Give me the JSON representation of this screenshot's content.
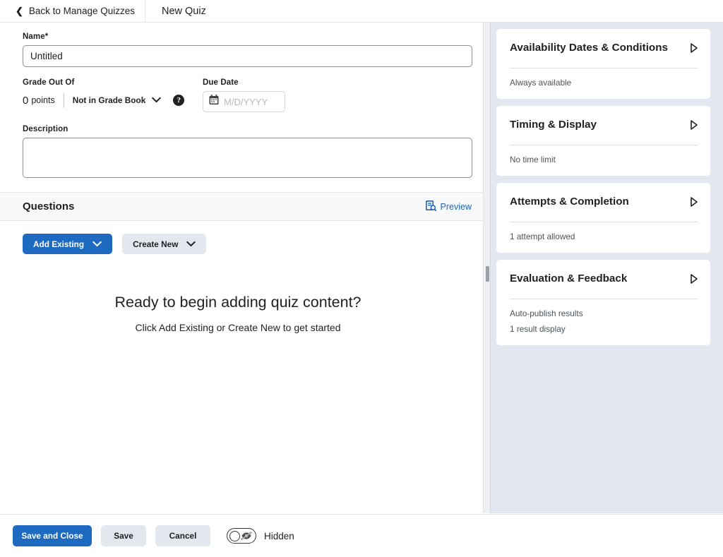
{
  "topbar": {
    "back_label": "Back to Manage Quizzes",
    "back_icon": "chevron-left-icon",
    "tab_label": "New Quiz"
  },
  "form": {
    "name_label": "Name",
    "name_required_marker": "*",
    "name_value": "Untitled",
    "name_placeholder": "Untitled",
    "grade_out_of_label": "Grade Out Of",
    "points_value": "0",
    "points_unit": "points",
    "grade_book_select": "Not in Grade Book",
    "grade_book_chevron": "chevron-down-icon",
    "help_icon": "help-circle-icon",
    "help_glyph": "?",
    "due_date_label": "Due Date",
    "due_date_value": "",
    "due_date_placeholder": "M/D/YYYY",
    "calendar_icon": "calendar-icon",
    "description_label": "Description",
    "description_value": ""
  },
  "questions": {
    "section_title": "Questions",
    "preview_label": "Preview",
    "preview_icon": "document-search-icon",
    "add_existing_label": "Add Existing",
    "add_existing_chevron": "chevron-down-icon",
    "create_new_label": "Create New",
    "create_new_chevron": "chevron-down-icon",
    "empty_title": "Ready to begin adding quiz content?",
    "empty_subtitle": "Click Add Existing or Create New to get started"
  },
  "splitter": {
    "grip_icon": "resize-grip-icon"
  },
  "panel": {
    "cards": [
      {
        "title": "Availability Dates & Conditions",
        "arrow_icon": "triangle-right-icon",
        "lines": [
          "Always available"
        ]
      },
      {
        "title": "Timing & Display",
        "arrow_icon": "triangle-right-icon",
        "lines": [
          "No time limit"
        ]
      },
      {
        "title": "Attempts & Completion",
        "arrow_icon": "triangle-right-icon",
        "lines": [
          "1 attempt allowed"
        ]
      },
      {
        "title": "Evaluation & Feedback",
        "arrow_icon": "triangle-right-icon",
        "lines": [
          "Auto-publish results",
          "1 result display"
        ]
      }
    ]
  },
  "footer": {
    "save_and_close_label": "Save and Close",
    "save_label": "Save",
    "cancel_label": "Cancel",
    "visibility_toggle_state": "off",
    "visibility_toggle_icon": "eye-slash-icon",
    "visibility_label": "Hidden"
  },
  "colors": {
    "primary_blue": "#1d6ac0",
    "link_blue": "#1e63b0",
    "secondary_button": "#e3e7ee",
    "panel_background": "#e3e7f0",
    "text": "#202122",
    "muted_text": "#4c5256"
  }
}
